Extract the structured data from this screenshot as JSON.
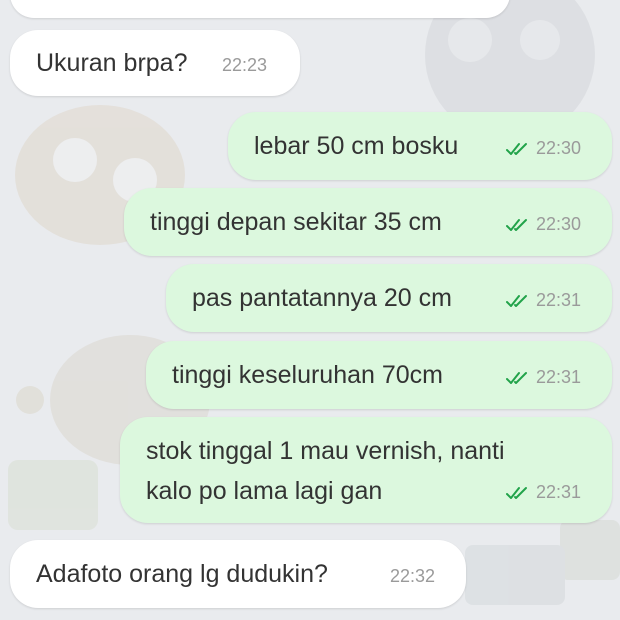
{
  "colors": {
    "incoming_bubble": "#ffffff",
    "outgoing_bubble": "#dcf8de",
    "read_tick": "#22a34a",
    "timestamp": "#9a9a9a",
    "chat_background": "#e9ebee"
  },
  "messages": [
    {
      "direction": "incoming",
      "text": "Ukuran brpa?",
      "time": "22:23"
    },
    {
      "direction": "outgoing",
      "text": "lebar 50 cm bosku",
      "time": "22:30",
      "status": "read"
    },
    {
      "direction": "outgoing",
      "text": "tinggi depan sekitar 35 cm",
      "time": "22:30",
      "status": "read"
    },
    {
      "direction": "outgoing",
      "text": "pas pantatannya 20 cm",
      "time": "22:31",
      "status": "read"
    },
    {
      "direction": "outgoing",
      "text": "tinggi keseluruhan 70cm",
      "time": "22:31",
      "status": "read"
    },
    {
      "direction": "outgoing",
      "lines": [
        "stok tinggal 1 mau vernish, nanti",
        "kalo po lama lagi gan"
      ],
      "time": "22:31",
      "status": "read"
    },
    {
      "direction": "incoming",
      "text": "Adafoto orang lg dudukin?",
      "time": "22:32"
    }
  ]
}
